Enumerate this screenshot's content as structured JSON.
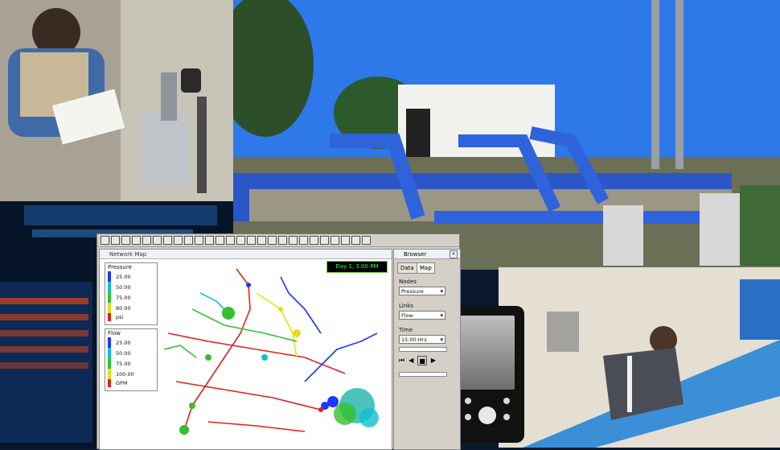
{
  "network_window": {
    "title": "Network Map",
    "time_display": "Day 1, 3:00 PM"
  },
  "legend_pressure": {
    "title": "Pressure",
    "entries": [
      {
        "label": "25.00",
        "color": "#1f36ff"
      },
      {
        "label": "50.00",
        "color": "#10c0d0"
      },
      {
        "label": "75.00",
        "color": "#34c02d"
      },
      {
        "label": "80.00",
        "color": "#e0e020"
      },
      {
        "label": "psi",
        "color": "#e02020"
      }
    ]
  },
  "legend_flow": {
    "title": "Flow",
    "entries": [
      {
        "label": "25.00",
        "color": "#1f36ff"
      },
      {
        "label": "50.00",
        "color": "#10c0d0"
      },
      {
        "label": "75.00",
        "color": "#34c02d"
      },
      {
        "label": "100.00",
        "color": "#e0e020"
      },
      {
        "label": "GPM",
        "color": "#e02020"
      }
    ]
  },
  "browser": {
    "title": "Browser",
    "tabs": [
      "Data",
      "Map"
    ],
    "nodes_label": "Nodes",
    "nodes_value": "Pressure",
    "links_label": "Links",
    "links_value": "Flow",
    "time_label": "Time",
    "time_value": "15:00 Hrs"
  },
  "colors": {
    "sky": "#2a74e6",
    "pipe_blue": "#2a5fd8",
    "window_gray": "#d4d0c8"
  }
}
